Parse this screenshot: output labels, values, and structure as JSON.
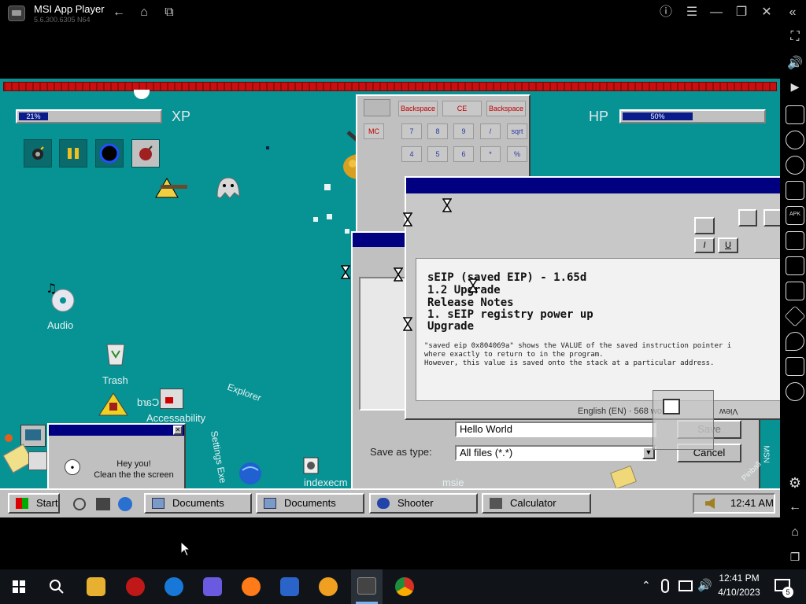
{
  "emulator": {
    "title": "MSI App Player",
    "version": "5.6.300.6305 N64",
    "top_icons": [
      "back-arrow-icon",
      "home-icon",
      "recent-apps-icon"
    ],
    "window_icons": [
      "help-icon",
      "menu-icon",
      "minimize-icon",
      "restore-icon",
      "close-icon",
      "collapse-sidebar-icon"
    ]
  },
  "game": {
    "xp": {
      "label": "XP",
      "percent_text": "21%",
      "value": 0.21
    },
    "hp": {
      "label": "HP",
      "percent_text": "50%",
      "value": 0.5
    },
    "powerups": [
      "bomb-powerup-icon",
      "gold-bars-powerup-icon",
      "black-hole-powerup-icon",
      "red-bomb-powerup-icon"
    ],
    "calculator": {
      "keys_top": [
        "Backspace",
        "CE",
        "Backspace"
      ],
      "mc": "MC",
      "row1": [
        "7",
        "8",
        "9",
        "/",
        "sqrt"
      ],
      "row2": [
        "4",
        "5",
        "6",
        "*",
        "%"
      ]
    },
    "popup": {
      "line1": "sEIP (saved EIP) - 1.65d",
      "line2": "1.2 Upgrade",
      "line3": "Release Notes",
      "line4": "1. sEIP registry power up",
      "line5": "Upgrade",
      "body1": "\"saved eip 0x804069a\" shows the VALUE of the saved instruction pointer i",
      "body2": "where exactly to return to in the program.",
      "body3": "However, this value is saved onto the stack at a particular address.",
      "status": "English (EN) · 568 wo",
      "view": "View"
    },
    "format_buttons": [
      "I",
      "U"
    ],
    "save_dialog": {
      "filename": "Hello World",
      "save_as_type_label": "Save as type:",
      "save_as_type_value": "All files (*.*)",
      "save_button": "Save",
      "cancel_button": "Cancel"
    },
    "clippy": {
      "line1": "Hey you!",
      "line2": "Clean the the screen"
    },
    "desktop_icons": {
      "audio": "Audio",
      "trash": "Trash",
      "accessibility": "Accessability",
      "card": "Card",
      "explorer": "Explorer",
      "settings": "Settings Exe",
      "indexecm": "indexecm",
      "msie": "msie",
      "msn": "MSN",
      "pinball": "Pinball"
    },
    "taskbar": {
      "start": "Start",
      "tasks": [
        "Documents",
        "Documents",
        "Shooter",
        "Calculator"
      ],
      "clock": "12:41 AM"
    }
  },
  "windows_taskbar": {
    "time": "12:41 PM",
    "date": "4/10/2023",
    "notifications": "5"
  }
}
